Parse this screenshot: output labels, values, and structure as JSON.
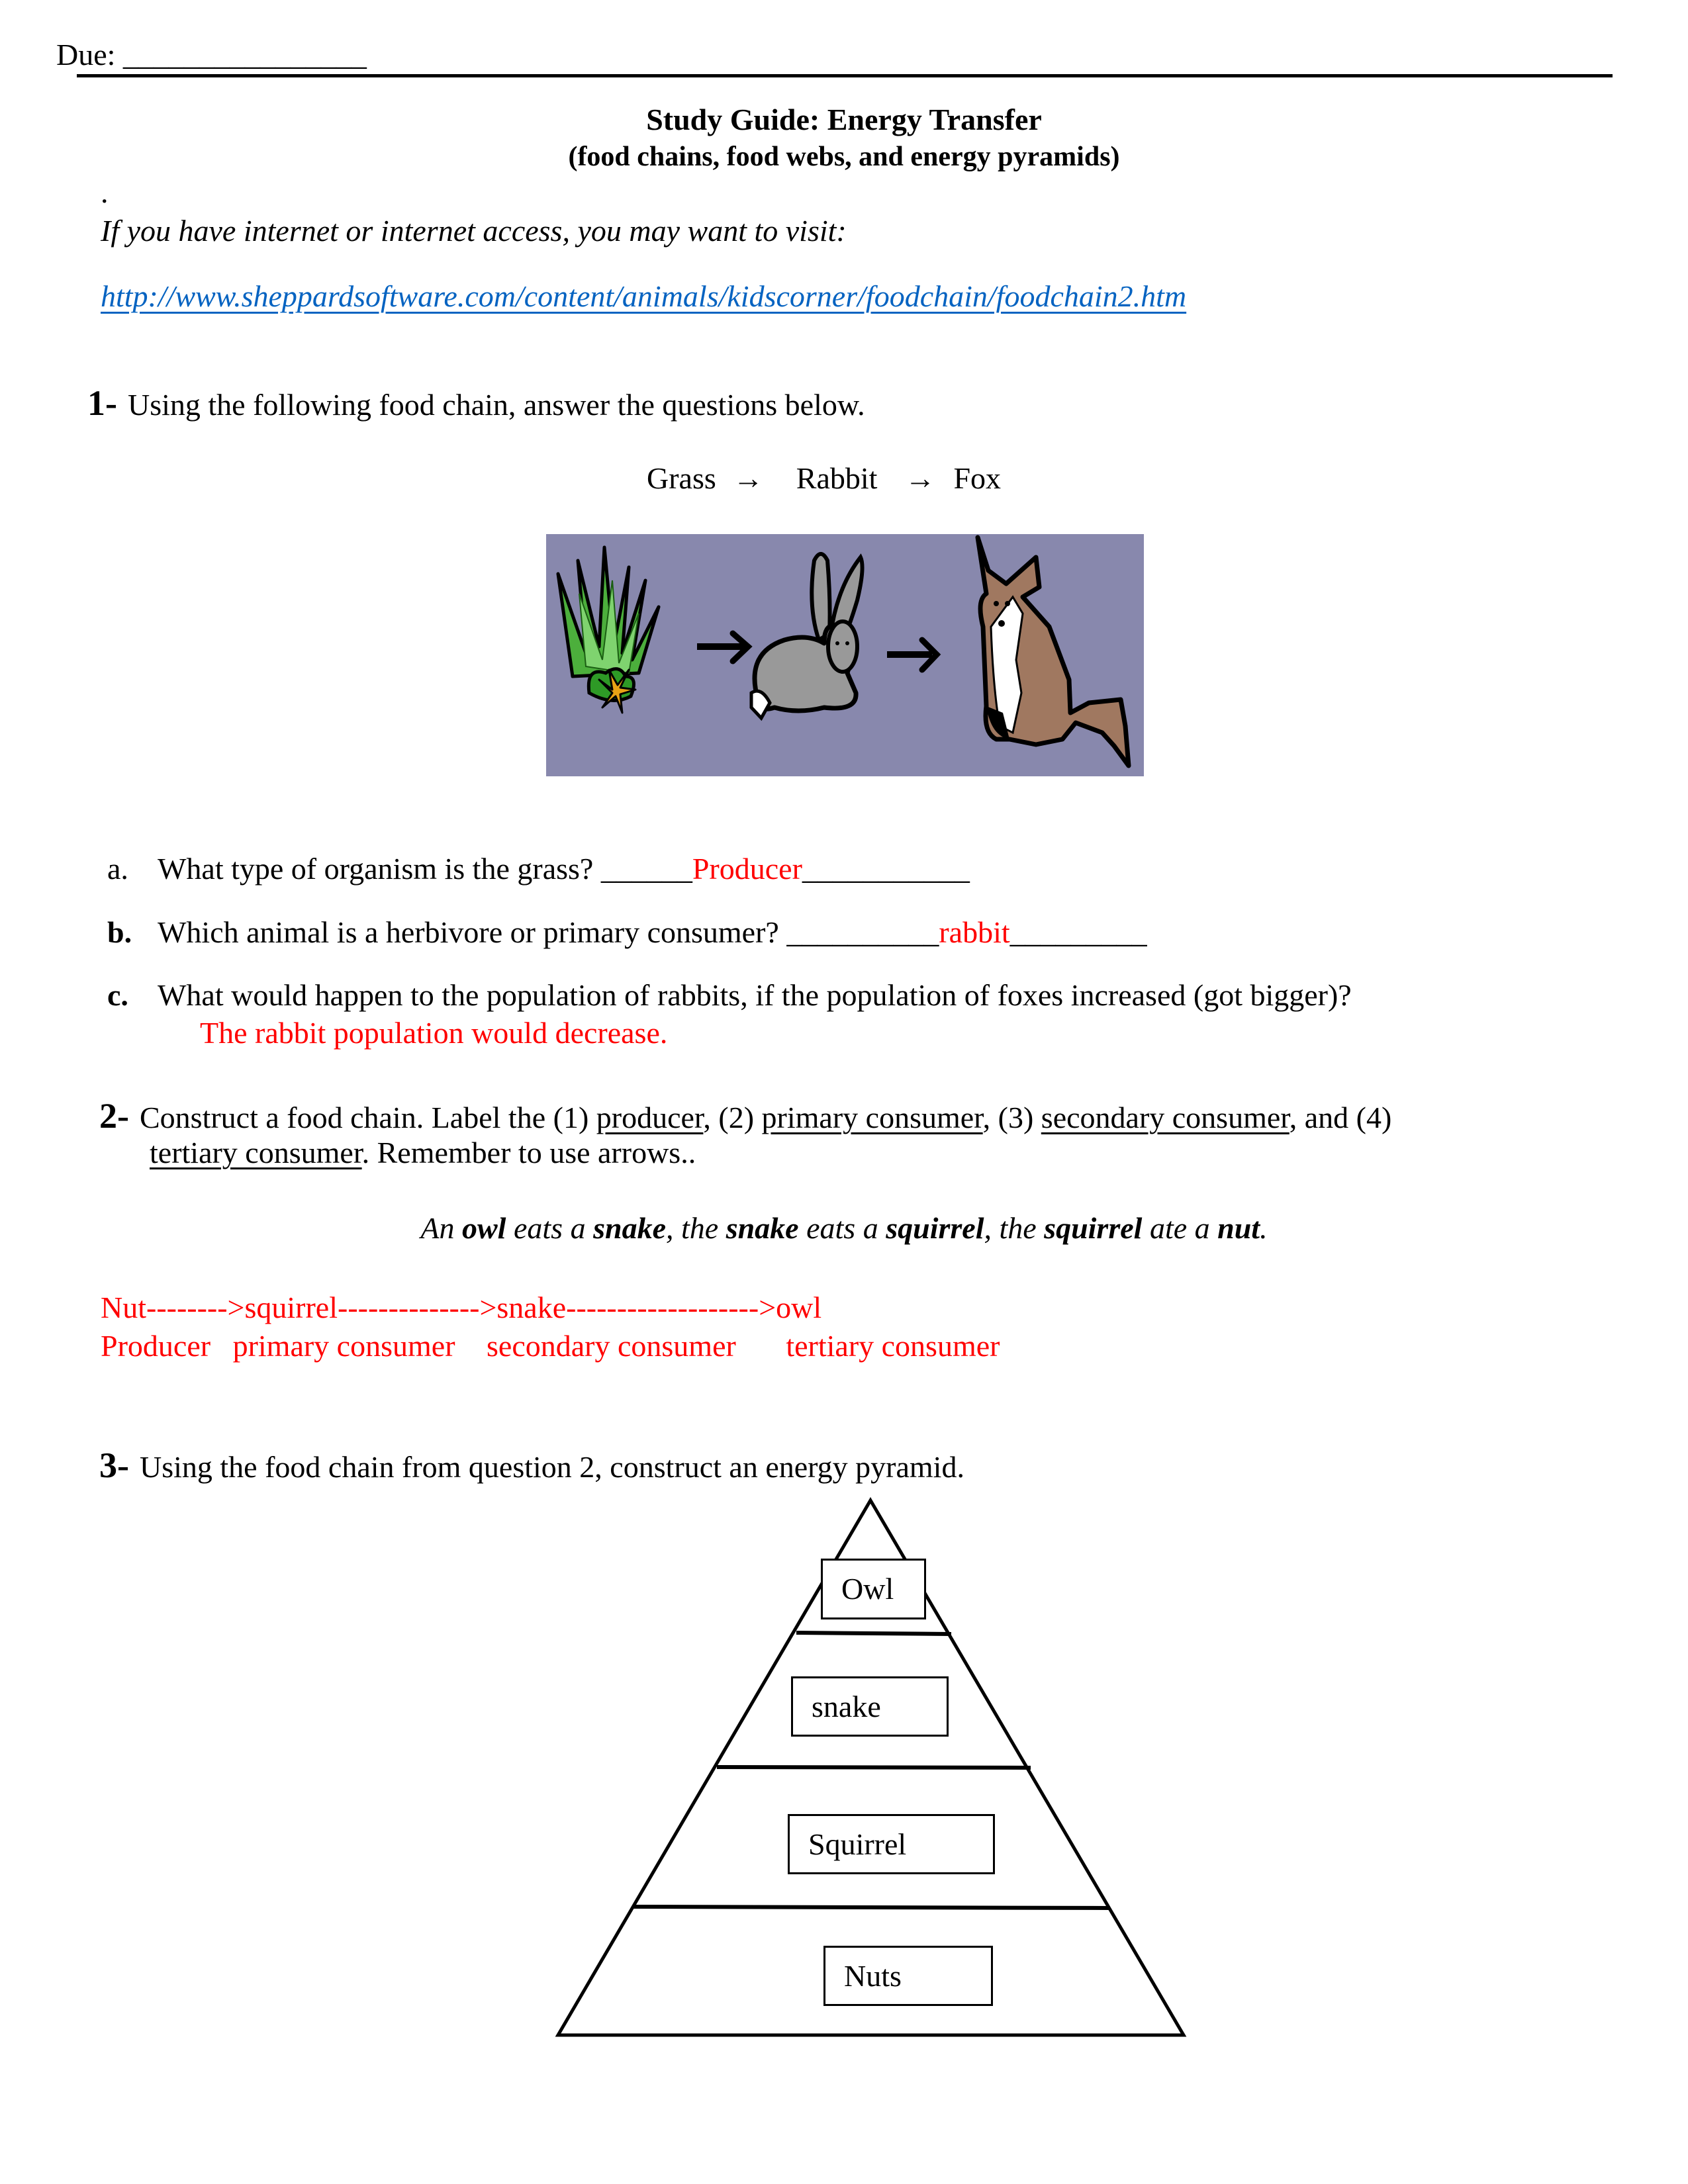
{
  "header": {
    "due_label": "Due:",
    "due_blank": "________________"
  },
  "title": {
    "main": "Study Guide: Energy Transfer",
    "subtitle": "(food chains, food webs, and energy pyramids)"
  },
  "intro": {
    "dot": ".",
    "visit_text": "If you have internet or internet access, you may want to visit:",
    "link_text": "http://www.sheppardsoftware.com/content/animals/kidscorner/foodchain/foodchain2.htm",
    "link_color": "#0563c1"
  },
  "q1": {
    "number": "1-",
    "prompt": "Using the following food chain, answer the questions below.",
    "chain": [
      "Grass",
      "Rabbit",
      "Fox"
    ],
    "arrow_icon": "right-arrow-icon",
    "image_description": "Grass → Rabbit → Fox illustration",
    "image_bg_color": "#8888ad",
    "parts": [
      {
        "letter": "a.",
        "question": "What type of organism is the grass?",
        "blank_before": "______",
        "answer": "Producer",
        "blank_after": "___________"
      },
      {
        "letter": "b.",
        "question": "Which animal is a herbivore or primary consumer?",
        "blank_before": "__________",
        "answer": "rabbit",
        "blank_after": "_________"
      },
      {
        "letter": "c.",
        "question": "What would happen to the population of rabbits, if the population of foxes increased (got bigger)?",
        "answer": "The rabbit population would decrease."
      }
    ]
  },
  "q2": {
    "number": "2-",
    "prompt_parts": {
      "p1": "Construct a food chain.  Label the (1) ",
      "producer": "producer",
      "p2": ", (2) ",
      "primary": "primary consumer",
      "p3": ", (3) ",
      "secondary": "secondary consumer",
      "p4": ", and (4)",
      "tertiary": "tertiary consumer",
      "p5": ".  Remember to use arrows.."
    },
    "sentence": {
      "s1": "An ",
      "owl": "owl",
      "s2": " eats a ",
      "snake": "snake",
      "s3": ", the ",
      "snake2": "snake",
      "s4": " eats a ",
      "squirrel": "squirrel",
      "s5": ", the ",
      "squirrel2": "squirrel",
      "s6": " ate a ",
      "nut": "nut",
      "s7": "."
    },
    "answer_chain": "Nut-------->squirrel-------------->snake------------------->owl",
    "answer_labels": [
      "Producer",
      "primary consumer",
      "secondary consumer",
      "tertiary consumer"
    ],
    "answer_color": "#ff0000"
  },
  "q3": {
    "number": "3-",
    "prompt": "Using the food chain from question 2, construct an energy pyramid.",
    "pyramid_levels": [
      "Owl",
      "snake",
      "Squirrel",
      "Nuts"
    ]
  }
}
